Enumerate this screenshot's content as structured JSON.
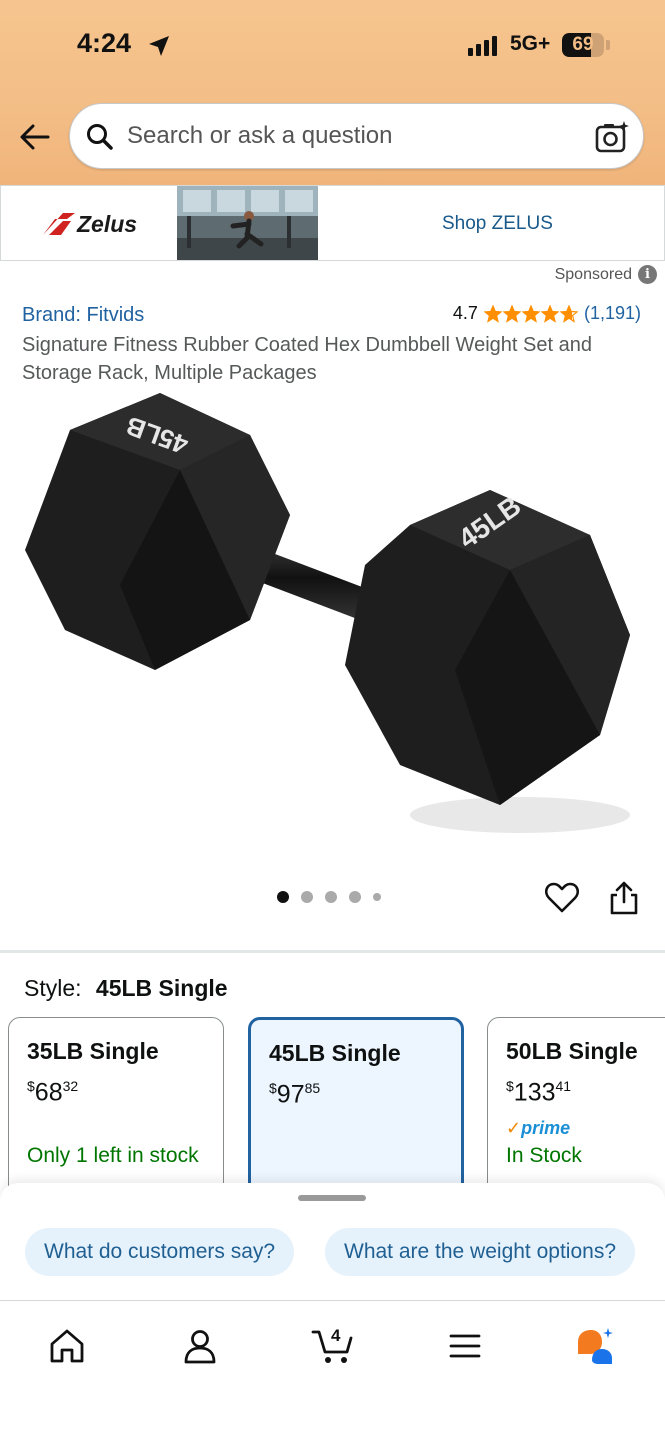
{
  "status_bar": {
    "time": "4:24",
    "network": "5G+",
    "battery": "69",
    "battery_fraction": 0.69
  },
  "search": {
    "placeholder": "Search or ask a question"
  },
  "sponsored_banner": {
    "brand_logo_text": "Zelus",
    "shop_link": "Shop ZELUS",
    "sponsored_label": "Sponsored",
    "info_icon_glyph": "i"
  },
  "product": {
    "brand": "Brand: Fitvids",
    "rating": "4.7",
    "rating_count": "(1,191)",
    "star_fill": 4.7,
    "title": "Signature Fitness Rubber Coated Hex Dumbbell Weight Set and Storage Rack, Multiple Packages",
    "image_labels": [
      "45LB",
      "45LB"
    ],
    "image_count": 5,
    "current_image": 1
  },
  "style": {
    "label": "Style:",
    "selected": "45LB Single",
    "options": [
      {
        "name": "35LB Single",
        "currency": "$",
        "whole": "68",
        "fraction": "32",
        "stock": "Only 1 left in stock",
        "prime": "",
        "selected": false
      },
      {
        "name": "45LB Single",
        "currency": "$",
        "whole": "97",
        "fraction": "85",
        "stock": "",
        "prime": "",
        "selected": true
      },
      {
        "name": "50LB Single",
        "currency": "$",
        "whole": "133",
        "fraction": "41",
        "stock": "In Stock",
        "prime": "prime",
        "selected": false
      }
    ]
  },
  "prompt_chips": [
    "What do customers say?",
    "What are the weight options?"
  ],
  "tab_bar": {
    "items": [
      "home-icon",
      "account-icon",
      "cart-icon",
      "menu-icon",
      "rufus-assistant-icon"
    ],
    "cart_count": "4"
  },
  "colors": {
    "header": "#f3bd86",
    "link": "#2162a1",
    "in_stock": "#007600",
    "star": "#ff8f00",
    "selected_border": "#2162a1",
    "chip_bg": "#e6f2fb"
  }
}
